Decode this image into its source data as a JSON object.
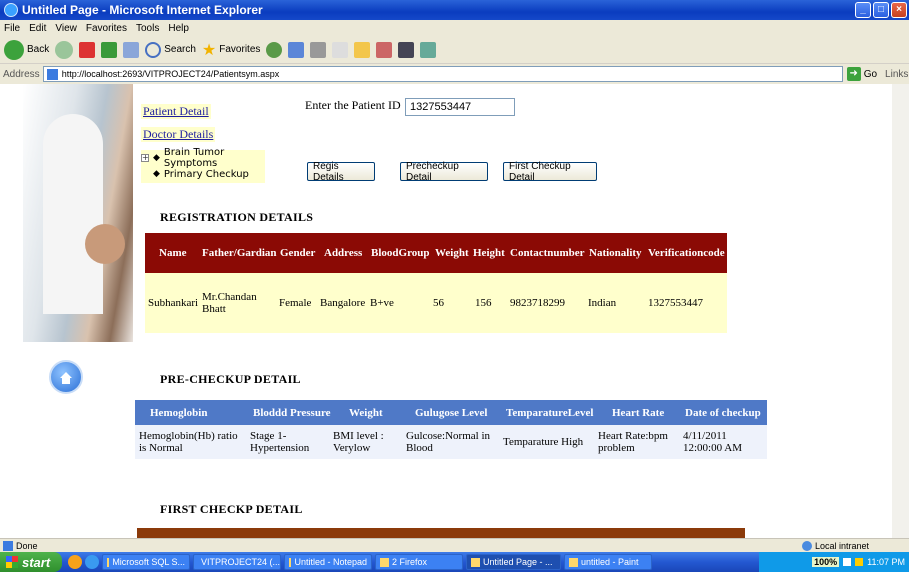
{
  "window": {
    "title": "Untitled Page - Microsoft Internet Explorer"
  },
  "menu": [
    "File",
    "Edit",
    "View",
    "Favorites",
    "Tools",
    "Help"
  ],
  "toolbar": {
    "back": "Back",
    "search": "Search",
    "favorites": "Favorites"
  },
  "address": {
    "label": "Address",
    "url": "http://localhost:2693/VITPROJECT24/Patientsym.aspx",
    "go": "Go",
    "links": "Links"
  },
  "nav": {
    "patient_detail": "Patient Detail",
    "doctor_details": "Doctor Details",
    "tree": [
      "Brain Tumor Symptoms",
      "Primary Checkup"
    ]
  },
  "patient_id": {
    "label": "Enter the Patient ID",
    "value": "1327553447"
  },
  "buttons": {
    "regis": "Regis Details",
    "precheckup": "Precheckup Detail",
    "first": "First Checkup Detail"
  },
  "registration": {
    "title": "REGISTRATION DETAILS",
    "headers": [
      "Name",
      "Father/Gardian",
      "Gender",
      "Address",
      "BloodGroup",
      "Weight",
      "Height",
      "Contactnumber",
      "Nationality",
      "Verificationcode"
    ],
    "row": [
      "Subhankari",
      "Mr.Chandan Bhatt",
      "Female",
      "Bangalore",
      "B+ve",
      "56",
      "156",
      "9823718299",
      "Indian",
      "1327553447"
    ]
  },
  "precheckup": {
    "title": "PRE-CHECKUP DETAIL",
    "headers": [
      "Hemoglobin",
      "Bloddd Pressure",
      "Weight",
      "Gulugose Level",
      "TemparatureLevel",
      "Heart Rate",
      "Date of checkup"
    ],
    "row": [
      "Hemoglobin(Hb) ratio is Normal",
      "Stage 1-Hypertension",
      "BMI level : Verylow",
      "Gulcose:Normal in Blood",
      "Temparature High",
      "Heart Rate:bpm problem",
      "4/11/2011 12:00:00 AM"
    ]
  },
  "first_checkup": {
    "title": "FIRST CHECKP DETAIL"
  },
  "status": {
    "text": "Done",
    "zone": "Local intranet"
  },
  "taskbar": {
    "start": "start",
    "tasks": [
      "Microsoft SQL S...",
      "VITPROJECT24 (...",
      "Untitled - Notepad",
      "2 Firefox",
      "Untitled Page - ...",
      "untitled - Paint"
    ],
    "zoom": "100%",
    "clock": "11:07 PM"
  }
}
